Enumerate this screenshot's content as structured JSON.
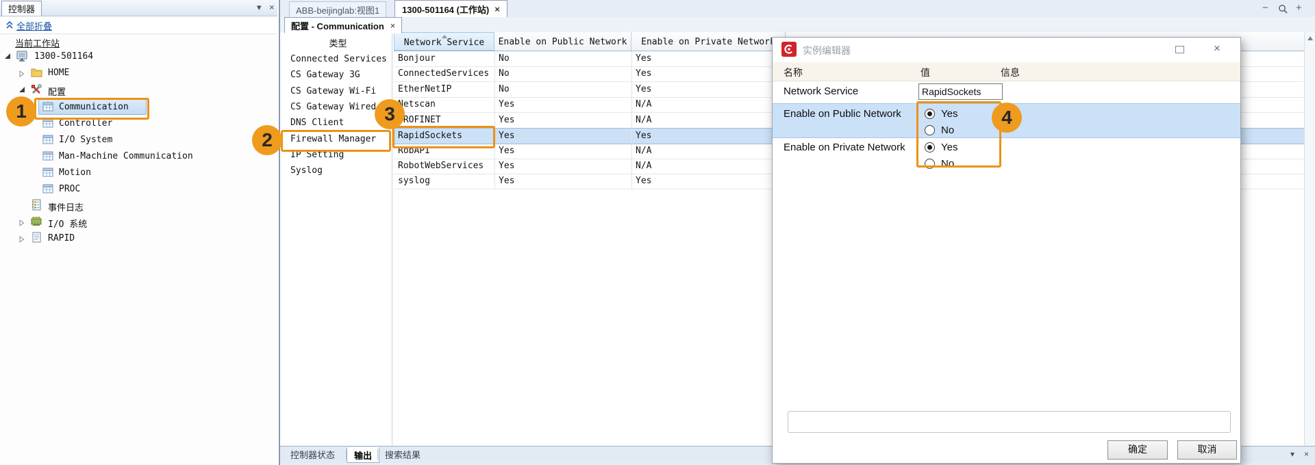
{
  "left_panel": {
    "title": "控制器",
    "collapse_all": "全部折叠",
    "current_station": "当前工作站",
    "tree": {
      "root": "1300-501164",
      "home": "HOME",
      "config": "配置",
      "config_children": [
        "Communication",
        "Controller",
        "I/O System",
        "Man-Machine Communication",
        "Motion",
        "PROC"
      ],
      "event_log": "事件日志",
      "io_system": "I/O 系统",
      "rapid": "RAPID"
    }
  },
  "doc_tabs": {
    "view_tab": "ABB-beijinglab:视图1",
    "station_tab": "1300-501164 (工作站)"
  },
  "sub_tab": "配置 - Communication",
  "type_list": {
    "header": "类型",
    "items": [
      "Connected Services",
      "CS Gateway 3G",
      "CS Gateway Wi-Fi",
      "CS Gateway Wired",
      "DNS Client",
      "Firewall Manager",
      "IP Setting",
      "Syslog"
    ]
  },
  "main_table": {
    "columns": [
      "Network Service",
      "Enable on Public Network",
      "Enable on Private Network"
    ],
    "rows": [
      {
        "service": "Bonjour",
        "public": "No",
        "private": "Yes"
      },
      {
        "service": "ConnectedServices",
        "public": "No",
        "private": "Yes"
      },
      {
        "service": "EtherNetIP",
        "public": "No",
        "private": "Yes"
      },
      {
        "service": "Netscan",
        "public": "Yes",
        "private": "N/A"
      },
      {
        "service": "PROFINET",
        "public": "Yes",
        "private": "N/A"
      },
      {
        "service": "RapidSockets",
        "public": "Yes",
        "private": "Yes"
      },
      {
        "service": "RobAPI",
        "public": "Yes",
        "private": "N/A"
      },
      {
        "service": "RobotWebServices",
        "public": "Yes",
        "private": "N/A"
      },
      {
        "service": "syslog",
        "public": "Yes",
        "private": "Yes"
      }
    ],
    "selected_row": "RapidSockets"
  },
  "dialog": {
    "title": "实例编辑器",
    "columns": {
      "name": "名称",
      "value": "值",
      "info": "信息"
    },
    "service_row": {
      "name": "Network Service",
      "value": "RapidSockets"
    },
    "public_row": {
      "name": "Enable on Public Network",
      "yes": "Yes",
      "no": "No",
      "selected": "Yes"
    },
    "private_row": {
      "name": "Enable on Private Network",
      "yes": "Yes",
      "no": "No",
      "selected": "Yes"
    },
    "comment_value": "",
    "ok_label": "确定",
    "cancel_label": "取消"
  },
  "bottom_bar": {
    "tabs": [
      "控制器状态",
      "输出",
      "搜索结果"
    ],
    "active_tab": "输出"
  },
  "annotations": {
    "badge1": "1",
    "badge2": "2",
    "badge3": "3",
    "badge4": "4"
  },
  "icons": {
    "close": "×",
    "minus": "−",
    "plus": "+",
    "dock": "▾"
  },
  "colors": {
    "annotation_orange": "#EB9214",
    "row_highlight": "#CCE0F6",
    "dialog_icon_red": "#D2232A",
    "link_blue": "#1A55A8"
  }
}
